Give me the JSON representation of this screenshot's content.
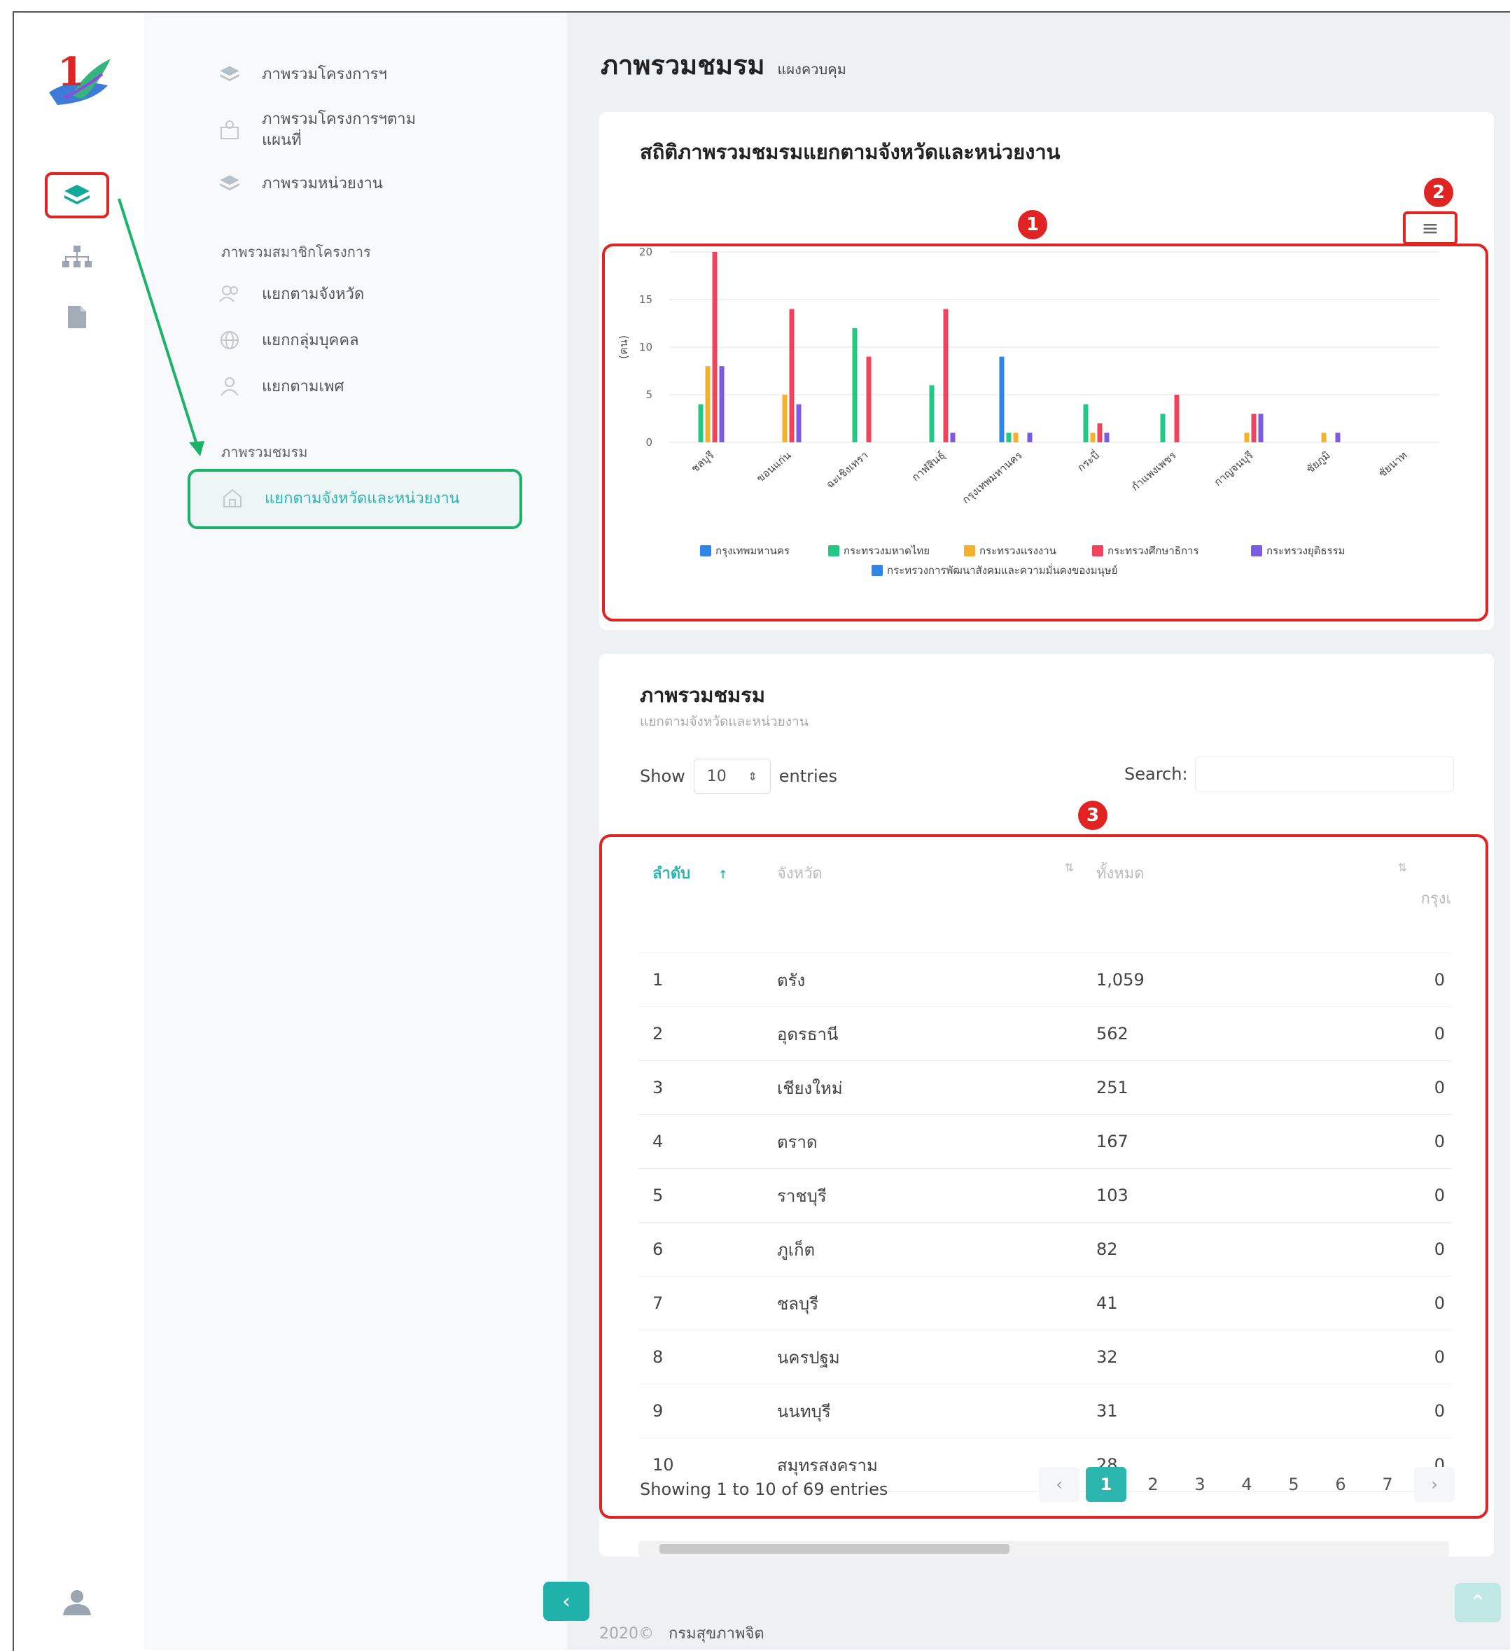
{
  "page": {
    "title": "ภาพรวมชมรม",
    "subtitle": "แผงควบคุม",
    "footer_year": "2020©",
    "footer_org": "กรมสุขภาพจิต"
  },
  "sidebar": {
    "items": [
      {
        "label": "ภาพรวมโครงการฯ",
        "icon": "layers-icon"
      },
      {
        "label": "ภาพรวมโครงการฯตามแผนที่",
        "icon": "map-icon"
      },
      {
        "label": "ภาพรวมหน่วยงาน",
        "icon": "layers-icon"
      }
    ],
    "section_members": "ภาพรวมสมาชิกโครงการ",
    "member_items": [
      {
        "label": "แยกตามจังหวัด",
        "icon": "users-icon"
      },
      {
        "label": "แยกกลุ่มบุคคล",
        "icon": "globe-icon"
      },
      {
        "label": "แยกตามเพศ",
        "icon": "user-icon"
      }
    ],
    "section_clubs": "ภาพรวมชมรม",
    "active_item": "แยกตามจังหวัดและหน่วยงาน"
  },
  "chart_card": {
    "title": "สถิติภาพรวมชมรมแยกตามจังหวัดและหน่วยงาน",
    "marker_chart": "1",
    "marker_menu": "2",
    "menu_icon": "≡"
  },
  "chart_data": {
    "type": "bar",
    "ylabel": "(คน)",
    "ylim": [
      0,
      20
    ],
    "yticks": [
      0,
      5,
      10,
      15,
      20
    ],
    "categories": [
      "ชลบุรี",
      "ขอนแก่น",
      "ฉะเชิงเทรา",
      "กาฬสินธุ์",
      "กรุงเทพมหานคร",
      "กระบี่",
      "กำแพงเพชร",
      "กาญจนบุรี",
      "ชัยภูมิ",
      "ชัยนาท"
    ],
    "series": [
      {
        "name": "กรุงเทพมหานคร",
        "color": "#2f86e8",
        "values": [
          0,
          0,
          0,
          0,
          9,
          0,
          0,
          0,
          0,
          0
        ]
      },
      {
        "name": "กระทรวงมหาดไทย",
        "color": "#22c985",
        "values": [
          4,
          0,
          12,
          6,
          1,
          4,
          3,
          0,
          0,
          0
        ]
      },
      {
        "name": "กระทรวงแรงงาน",
        "color": "#f5b12c",
        "values": [
          8,
          5,
          0,
          0,
          1,
          1,
          0,
          1,
          1,
          0
        ]
      },
      {
        "name": "กระทรวงศึกษาธิการ",
        "color": "#f0445e",
        "values": [
          20,
          14,
          9,
          14,
          0,
          2,
          5,
          3,
          0,
          0
        ]
      },
      {
        "name": "กระทรวงยุติธรรม",
        "color": "#7b5be0",
        "values": [
          8,
          4,
          0,
          1,
          1,
          1,
          0,
          3,
          1,
          0
        ]
      },
      {
        "name": "กระทรวงการพัฒนาสังคมและความมั่นคงของมนุษย์",
        "color": "#2f86e8",
        "values": [
          0,
          0,
          0,
          0,
          0,
          0,
          0,
          0,
          0,
          0
        ]
      }
    ]
  },
  "table_card": {
    "title": "ภาพรวมชมรม",
    "subtitle": "แยกตามจังหวัดและหน่วยงาน",
    "show_label": "Show",
    "show_value": "10",
    "entries_label": "entries",
    "search_label": "Search:",
    "marker_table": "3",
    "columns": [
      "ลำดับ",
      "จังหวัด",
      "ทั้งหมด",
      "กรุงเ"
    ],
    "rows": [
      [
        "1",
        "ตรัง",
        "1,059",
        "0"
      ],
      [
        "2",
        "อุดรธานี",
        "562",
        "0"
      ],
      [
        "3",
        "เชียงใหม่",
        "251",
        "0"
      ],
      [
        "4",
        "ตราด",
        "167",
        "0"
      ],
      [
        "5",
        "ราชบุรี",
        "103",
        "0"
      ],
      [
        "6",
        "ภูเก็ต",
        "82",
        "0"
      ],
      [
        "7",
        "ชลบุรี",
        "41",
        "0"
      ],
      [
        "8",
        "นครปฐม",
        "32",
        "0"
      ],
      [
        "9",
        "นนทบุรี",
        "31",
        "0"
      ],
      [
        "10",
        "สมุทรสงคราม",
        "28",
        "0"
      ]
    ],
    "info": "Showing 1 to 10 of 69 entries",
    "pages": [
      "1",
      "2",
      "3",
      "4",
      "5",
      "6",
      "7"
    ],
    "current_page": "1",
    "prev": "‹",
    "next": "›"
  },
  "logo_text": "1"
}
